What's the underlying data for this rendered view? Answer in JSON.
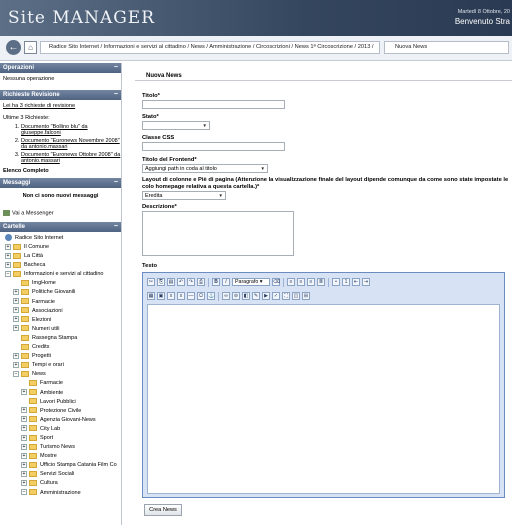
{
  "header": {
    "logo": "Site MANAGER",
    "date": "Martedì 8 Ottobre, 20",
    "welcome": "Benvenuto Stra"
  },
  "nav": {
    "back_icon": "back-arrow-icon",
    "home_icon": "home-icon",
    "breadcrumb": "Radice Sito Internet / Informazioni e servizi al cittadino / News / Amministrazione / Circoscrizioni / News 1ª Circoscrizione / 2013 /",
    "current": "Nuova News"
  },
  "sidebar": {
    "operazioni": {
      "title": "Operazioni",
      "text": "Nessuna operazione"
    },
    "revisioni": {
      "title": "Richieste Revisione",
      "link": "Lei ha 3 richieste di revisione",
      "subtitle": "Ultime 3 Richieste:",
      "items": [
        "Documento \"Bollino blu\" da giuseppe.falconi",
        "Documento \"Euronews Novembre 2008\" da antonio.massari",
        "Documento \"Euronews Ottobre 2008\" da antonio.massari"
      ],
      "footer": "Elenco Completo"
    },
    "messaggi": {
      "title": "Messaggi",
      "text": "Non ci sono nuovi messaggi",
      "link": "Vai a Messenger"
    },
    "cartelle": {
      "title": "Cartelle",
      "root": "Radice Sito Internet",
      "tree": [
        {
          "label": "Il Comune",
          "level": 1,
          "pm": "+"
        },
        {
          "label": "La Città",
          "level": 1,
          "pm": "+"
        },
        {
          "label": "Bacheca",
          "level": 1,
          "pm": "+"
        },
        {
          "label": "Informazioni e servizi al cittadino",
          "level": 1,
          "pm": "−"
        },
        {
          "label": "ImgHome",
          "level": 2,
          "pm": ""
        },
        {
          "label": "Politiche Giovanili",
          "level": 2,
          "pm": "+"
        },
        {
          "label": "Farmacie",
          "level": 2,
          "pm": "+"
        },
        {
          "label": "Associazioni",
          "level": 2,
          "pm": "+"
        },
        {
          "label": "Elezioni",
          "level": 2,
          "pm": "+"
        },
        {
          "label": "Numeri utili",
          "level": 2,
          "pm": "+"
        },
        {
          "label": "Rassegna Stampa",
          "level": 2,
          "pm": ""
        },
        {
          "label": "Credits",
          "level": 2,
          "pm": ""
        },
        {
          "label": "Progetti",
          "level": 2,
          "pm": "+"
        },
        {
          "label": "Tempi e orari",
          "level": 2,
          "pm": "+"
        },
        {
          "label": "News",
          "level": 2,
          "pm": "−"
        },
        {
          "label": "Farmacie",
          "level": 3,
          "pm": ""
        },
        {
          "label": "Ambiente",
          "level": 3,
          "pm": "+"
        },
        {
          "label": "Lavori Pubblici",
          "level": 3,
          "pm": ""
        },
        {
          "label": "Protezione Civile",
          "level": 3,
          "pm": "+"
        },
        {
          "label": "Agenzia Giovani-News",
          "level": 3,
          "pm": "+"
        },
        {
          "label": "City Lab",
          "level": 3,
          "pm": "+"
        },
        {
          "label": "Sport",
          "level": 3,
          "pm": "+"
        },
        {
          "label": "Turismo News",
          "level": 3,
          "pm": "+"
        },
        {
          "label": "Mostre",
          "level": 3,
          "pm": "+"
        },
        {
          "label": "Ufficio Stampa Catania Film Co",
          "level": 3,
          "pm": "+"
        },
        {
          "label": "Servizi Sociali",
          "level": 3,
          "pm": "+"
        },
        {
          "label": "Cultura",
          "level": 3,
          "pm": "+"
        },
        {
          "label": "Amministrazione",
          "level": 3,
          "pm": "−"
        }
      ]
    }
  },
  "form": {
    "legend": "Nuova News",
    "titolo": "Titolo*",
    "stato": "Stato*",
    "classe": "Classe CSS",
    "titolo_frontend": "Titolo del Frontend*",
    "titolo_frontend_value": "Aggiungi path in coda al titolo",
    "layout": "Layout di colonne e Piè di pagina (Attenzione la visualizzazione finale del layout dipende comunque da come sono state impostate le colo homepage relativa a questa cartella.)*",
    "layout_value": "Eredita",
    "descrizione": "Descrizione*",
    "testo": "Testo",
    "paragraph": "Paragrafo",
    "submit": "Crea News"
  }
}
